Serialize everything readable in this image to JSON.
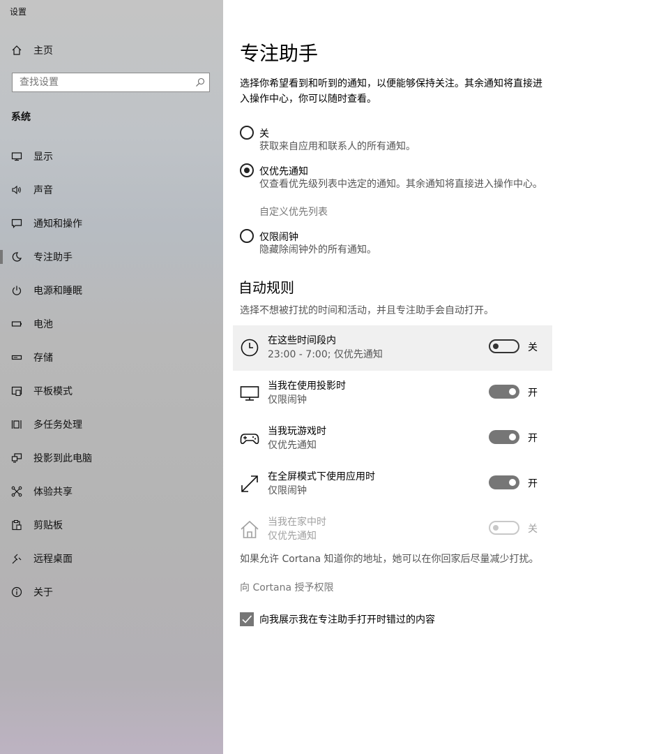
{
  "app": {
    "title": "设置"
  },
  "nav": {
    "home": {
      "label": "主页",
      "icon": "home-icon"
    },
    "search": {
      "placeholder": "查找设置"
    },
    "section": "系统",
    "items": [
      {
        "label": "显示",
        "icon": "monitor-icon"
      },
      {
        "label": "声音",
        "icon": "speaker-icon"
      },
      {
        "label": "通知和操作",
        "icon": "message-icon"
      },
      {
        "label": "专注助手",
        "icon": "moon-icon",
        "active": true
      },
      {
        "label": "电源和睡眠",
        "icon": "power-icon"
      },
      {
        "label": "电池",
        "icon": "battery-icon"
      },
      {
        "label": "存储",
        "icon": "storage-icon"
      },
      {
        "label": "平板模式",
        "icon": "tablet-icon"
      },
      {
        "label": "多任务处理",
        "icon": "multitask-icon"
      },
      {
        "label": "投影到此电脑",
        "icon": "project-icon"
      },
      {
        "label": "体验共享",
        "icon": "share-icon"
      },
      {
        "label": "剪贴板",
        "icon": "clipboard-icon"
      },
      {
        "label": "远程桌面",
        "icon": "remote-desktop-icon"
      },
      {
        "label": "关于",
        "icon": "info-icon"
      }
    ]
  },
  "page": {
    "title": "专注助手",
    "description": "选择你希望看到和听到的通知，以便能够保持关注。其余通知将直接进入操作中心，你可以随时查看。",
    "options": [
      {
        "label": "关",
        "desc": "获取来自应用和联系人的所有通知。",
        "selected": false
      },
      {
        "label": "仅优先通知",
        "desc": "仅查看优先级列表中选定的通知。其余通知将直接进入操作中心。",
        "link": "自定义优先列表",
        "selected": true
      },
      {
        "label": "仅限闹钟",
        "desc": "隐藏除闹钟外的所有通知。",
        "selected": false
      }
    ],
    "rules_title": "自动规则",
    "rules_desc": "选择不想被打扰的时间和活动，并且专注助手会自动打开。",
    "rules": [
      {
        "title": "在这些时间段内",
        "subtitle": "23:00 - 7:00; 仅优先通知",
        "state": "关",
        "on": false,
        "icon": "clock-icon"
      },
      {
        "title": "当我在使用投影时",
        "subtitle": "仅限闹钟",
        "state": "开",
        "on": true,
        "icon": "monitor-icon"
      },
      {
        "title": "当我玩游戏时",
        "subtitle": "仅优先通知",
        "state": "开",
        "on": true,
        "icon": "gamepad-icon"
      },
      {
        "title": "在全屏模式下使用应用时",
        "subtitle": "仅限闹钟",
        "state": "开",
        "on": true,
        "icon": "fullscreen-icon"
      },
      {
        "title": "当我在家中时",
        "subtitle": "仅优先通知",
        "state": "关",
        "on": false,
        "disabled": true,
        "icon": "home-icon"
      }
    ],
    "cortana_note": "如果允许 Cortana 知道你的地址，她可以在你回家后尽量减少打扰。",
    "cortana_link": "向 Cortana 授予权限",
    "checkbox_label": "向我展示我在专注助手打开时错过的内容",
    "checkbox_checked": true
  }
}
